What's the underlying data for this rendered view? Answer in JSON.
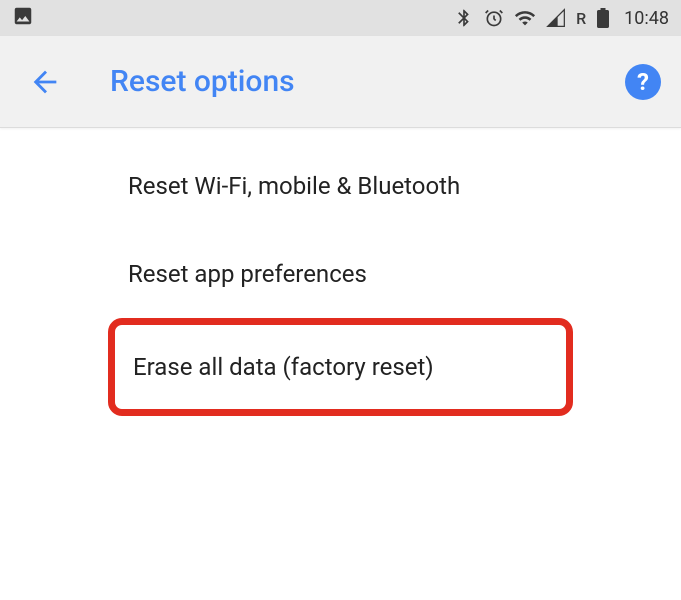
{
  "statusBar": {
    "time": "10:48",
    "roaming": "R"
  },
  "appBar": {
    "title": "Reset options",
    "helpLabel": "?"
  },
  "items": {
    "resetNetwork": "Reset Wi-Fi, mobile & Bluetooth",
    "resetAppPrefs": "Reset app preferences",
    "factoryReset": "Erase all data (factory reset)"
  }
}
